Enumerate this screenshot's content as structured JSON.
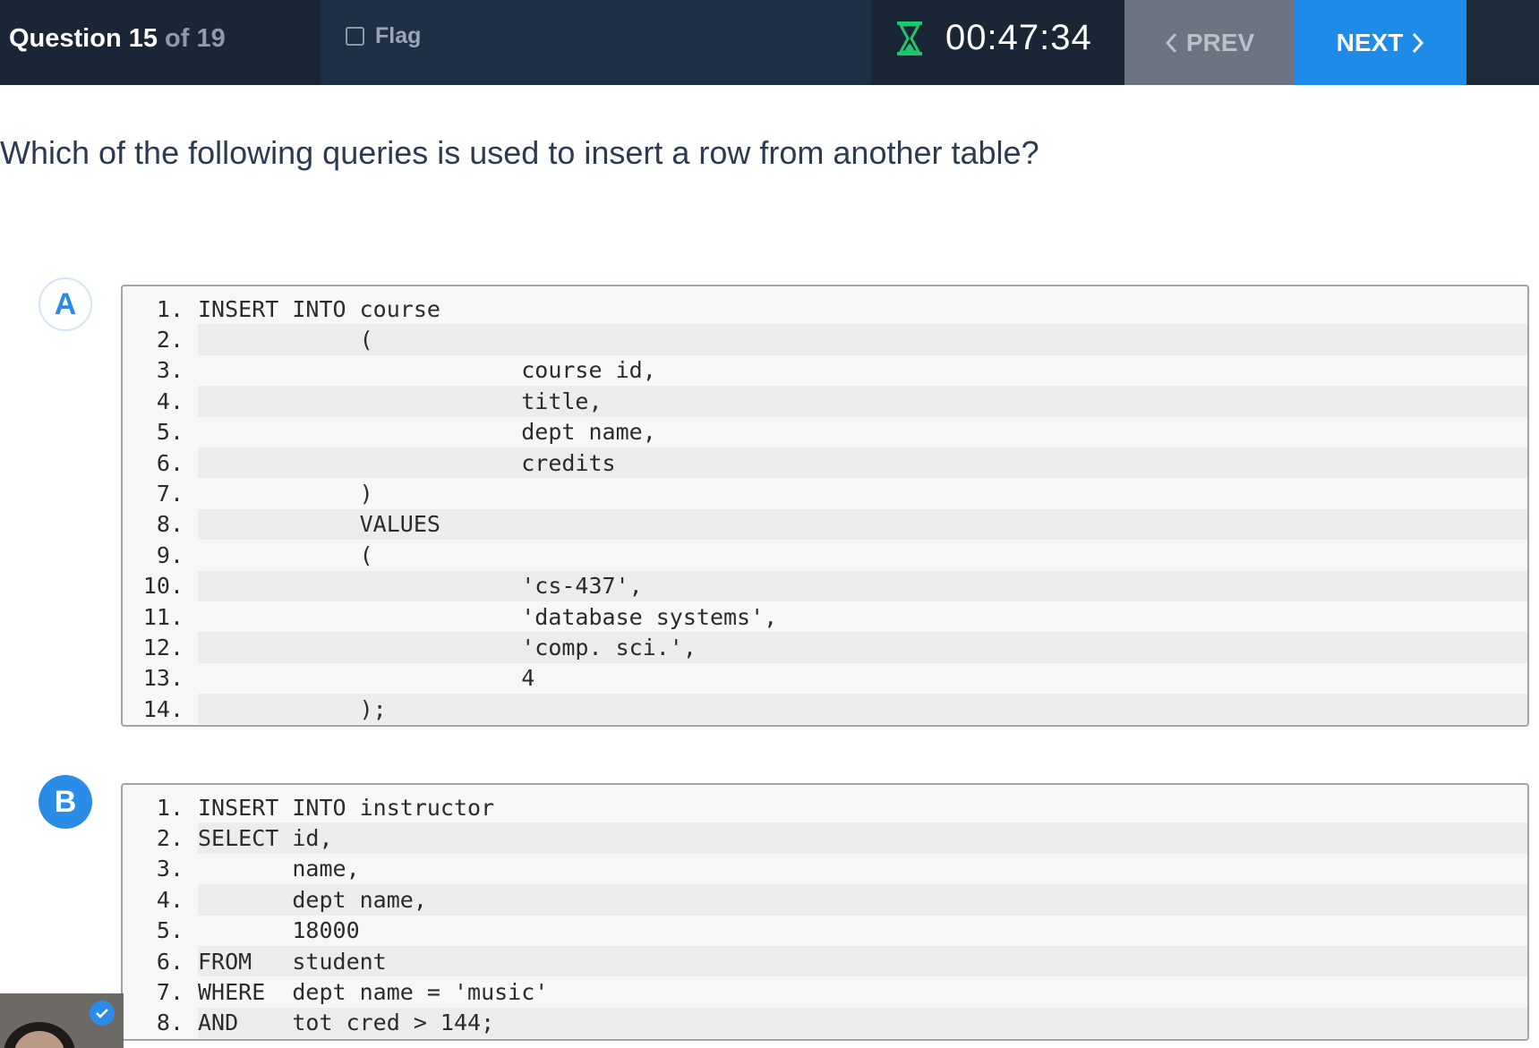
{
  "header": {
    "question_prefix": "Question 15",
    "question_suffix": " of 19",
    "flag_label": "Flag",
    "timer": "00:47:34",
    "prev_label": "PREV",
    "next_label": "NEXT"
  },
  "question": {
    "text": "Which of the following queries is used to insert a row from another table?"
  },
  "options": [
    {
      "letter": "A",
      "lines": [
        {
          "n": "1.",
          "code": "INSERT INTO course"
        },
        {
          "n": "2.",
          "code": "            ("
        },
        {
          "n": "3.",
          "code": "                        course id,"
        },
        {
          "n": "4.",
          "code": "                        title,"
        },
        {
          "n": "5.",
          "code": "                        dept name,"
        },
        {
          "n": "6.",
          "code": "                        credits"
        },
        {
          "n": "7.",
          "code": "            )"
        },
        {
          "n": "8.",
          "code": "            VALUES"
        },
        {
          "n": "9.",
          "code": "            ("
        },
        {
          "n": "10.",
          "code": "                        'cs-437',"
        },
        {
          "n": "11.",
          "code": "                        'database systems',"
        },
        {
          "n": "12.",
          "code": "                        'comp. sci.',"
        },
        {
          "n": "13.",
          "code": "                        4"
        },
        {
          "n": "14.",
          "code": "            );"
        }
      ]
    },
    {
      "letter": "B",
      "lines": [
        {
          "n": "1.",
          "code": "INSERT INTO instructor"
        },
        {
          "n": "2.",
          "code": "SELECT id,"
        },
        {
          "n": "3.",
          "code": "       name,"
        },
        {
          "n": "4.",
          "code": "       dept name,"
        },
        {
          "n": "5.",
          "code": "       18000"
        },
        {
          "n": "6.",
          "code": "FROM   student"
        },
        {
          "n": "7.",
          "code": "WHERE  dept name = 'music'"
        },
        {
          "n": "8.",
          "code": "AND    tot cred > 144;"
        }
      ]
    }
  ],
  "colors": {
    "accent": "#2a8ce6",
    "timer_icon": "#1fc66a",
    "topbar": "#1c2a3a"
  }
}
